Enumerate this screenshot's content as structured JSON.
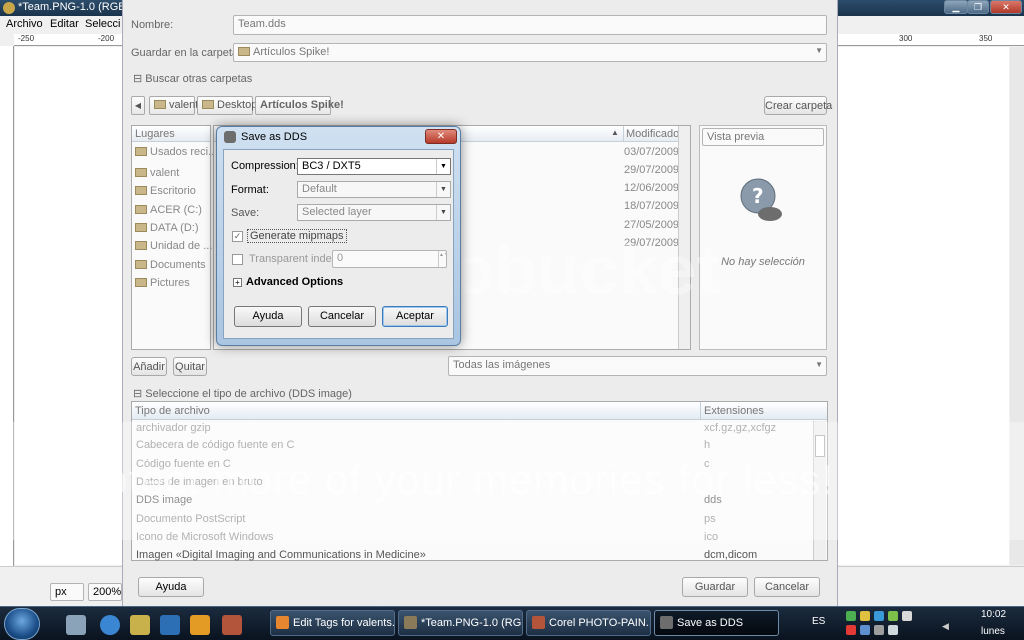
{
  "gimp": {
    "title": "*Team.PNG-1.0 (RGB, 1",
    "menu": [
      "Archivo",
      "Editar",
      "Selecci"
    ],
    "ruler_labels": [
      "-250",
      "-200",
      "300",
      "350"
    ],
    "unit": "px",
    "zoom": "200%"
  },
  "save_dialog": {
    "name_label": "Nombre:",
    "name_value": "Team.dds",
    "folder_label": "Guardar en la carpeta:",
    "folder_value": "Artículos Spike!",
    "browse_label": "Buscar otras carpetas",
    "path_buttons": [
      "valent",
      "Desktop",
      "Artículos Spike!"
    ],
    "create_folder": "Crear carpeta",
    "places_header": "Lugares",
    "places": [
      "Usados reci...",
      "valent",
      "Escritorio",
      "ACER (C:)",
      "DATA (D:)",
      "Unidad de ...",
      "Documents",
      "Pictures"
    ],
    "modified_header": "Modificado",
    "dates": [
      "03/07/2009",
      "29/07/2009",
      "12/06/2009",
      "18/07/2009",
      "27/05/2009",
      "29/07/2009"
    ],
    "preview_label": "Vista previa",
    "no_selection": "No hay selección",
    "add_button": "Añadir",
    "remove_button": "Quitar",
    "filter_value": "Todas las imágenes",
    "filetype_toggle": "Seleccione el tipo de archivo (DDS image)",
    "filetype_col_name": "Tipo de archivo",
    "filetype_col_ext": "Extensiones",
    "filetypes": [
      {
        "name": "archivador gzip",
        "ext": "xcf.gz,gz,xcfgz"
      },
      {
        "name": "Cabecera de código fuente en C",
        "ext": "h"
      },
      {
        "name": "Código fuente en C",
        "ext": "c"
      },
      {
        "name": "Datos de imagen en bruto",
        "ext": ""
      },
      {
        "name": "DDS image",
        "ext": "dds"
      },
      {
        "name": "Documento PostScript",
        "ext": "ps"
      },
      {
        "name": "Icono de Microsoft Windows",
        "ext": "ico"
      },
      {
        "name": "Imagen «Digital Imaging and Communications in Medicine»",
        "ext": "dcm,dicom"
      }
    ],
    "help_button": "Ayuda",
    "save_button": "Guardar",
    "cancel_button": "Cancelar"
  },
  "dds": {
    "title": "Save as DDS",
    "compression_label": "Compression:",
    "compression_value": "BC3 / DXT5",
    "format_label": "Format:",
    "format_value": "Default",
    "save_label": "Save:",
    "save_value": "Selected layer",
    "mipmaps_label": "Generate mipmaps",
    "mipmaps_checked": true,
    "transparent_label": "Transparent index:",
    "transparent_value": "0",
    "advanced_label": "Advanced Options",
    "help_button": "Ayuda",
    "cancel_button": "Cancelar",
    "ok_button": "Aceptar",
    "close_glyph": "✕"
  },
  "taskbar": {
    "tasks": [
      "Edit Tags for valents...",
      "*Team.PNG-1.0 (RG...",
      "Corel PHOTO-PAIN...",
      "Save as DDS"
    ],
    "language": "ES",
    "time": "10:02",
    "day": "lunes"
  },
  "watermark": {
    "logo": "photobucket",
    "text": "Protect more of your memories for less!"
  }
}
